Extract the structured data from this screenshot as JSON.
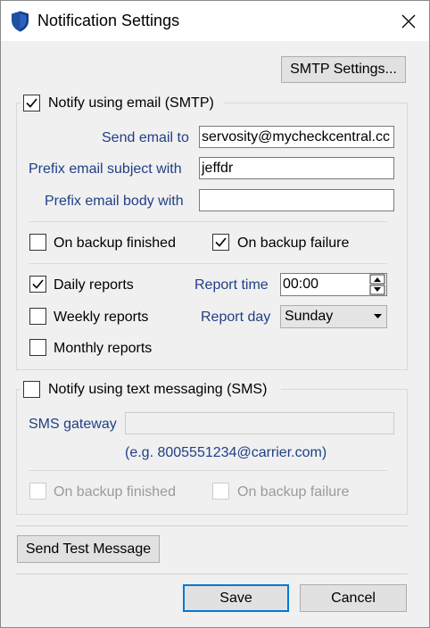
{
  "window": {
    "title": "Notification Settings"
  },
  "buttons": {
    "smtp_settings": "SMTP Settings...",
    "send_test": "Send Test Message",
    "save": "Save",
    "cancel": "Cancel"
  },
  "email": {
    "enabled_label": "Notify using email (SMTP)",
    "enabled": true,
    "send_to_label": "Send email to",
    "send_to_value": "servosity@mycheckcentral.cc",
    "subject_prefix_label": "Prefix email subject with",
    "subject_prefix_value": "jeffdr",
    "body_prefix_label": "Prefix email body with",
    "body_prefix_value": "",
    "on_backup_finished_label": "On backup finished",
    "on_backup_finished": false,
    "on_backup_failure_label": "On backup failure",
    "on_backup_failure": true
  },
  "reports": {
    "daily_label": "Daily reports",
    "daily": true,
    "weekly_label": "Weekly reports",
    "weekly": false,
    "monthly_label": "Monthly reports",
    "monthly": false,
    "report_time_label": "Report time",
    "report_time_value": "00:00",
    "report_day_label": "Report day",
    "report_day_value": "Sunday"
  },
  "sms": {
    "enabled_label": "Notify using text messaging (SMS)",
    "enabled": false,
    "gateway_label": "SMS gateway",
    "gateway_value": "",
    "gateway_example": "(e.g. 8005551234@carrier.com)",
    "on_backup_finished_label": "On backup finished",
    "on_backup_failure_label": "On backup failure"
  },
  "icons": {
    "app": "shield-icon",
    "close": "close-icon",
    "spin": "spin-arrows-icon",
    "dropdown": "chevron-down-icon"
  },
  "colors": {
    "accent": "#0078d7",
    "label_blue": "#1f3f86",
    "shield_blue": "#1e4fa3"
  }
}
